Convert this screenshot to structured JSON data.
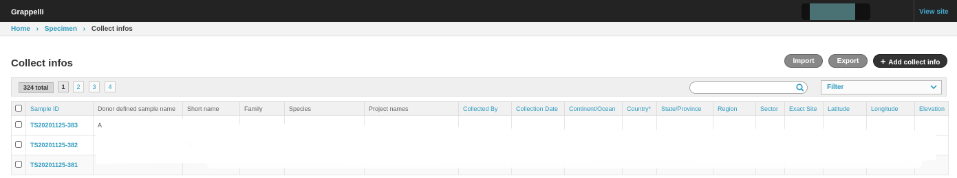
{
  "app": {
    "title": "Grappelli",
    "view_site": "View site"
  },
  "breadcrumb": {
    "home": "Home",
    "specimen": "Specimen",
    "current": "Collect infos"
  },
  "page_title": "Collect infos",
  "toolbar": {
    "import_label": "Import",
    "export_label": "Export",
    "add_label": "Add collect info"
  },
  "pagination": {
    "total": "324 total",
    "pages": [
      "1",
      "2",
      "3",
      "4"
    ],
    "current": "1"
  },
  "search": {
    "placeholder": ""
  },
  "filter": {
    "label": "Filter"
  },
  "table": {
    "columns": [
      "Sample ID",
      "Donor defined sample name",
      "Short name",
      "Family",
      "Species",
      "Project names",
      "Collected By",
      "Collection Date",
      "Continent/Ocean",
      "Country*",
      "State/Province",
      "Region",
      "Sector",
      "Exact Site",
      "Latitude",
      "Longitude",
      "Elevation"
    ],
    "rows": [
      {
        "sample_id": "TS20201125-383",
        "donor": "A",
        "short": ""
      },
      {
        "sample_id": "TS20201125-382",
        "donor": "",
        "short": "Yl"
      },
      {
        "sample_id": "TS20201125-381",
        "donor": "",
        "short": ""
      }
    ]
  },
  "colors": {
    "topbar": "#232323",
    "link": "#309bbf",
    "accent_dark": "#333333"
  }
}
